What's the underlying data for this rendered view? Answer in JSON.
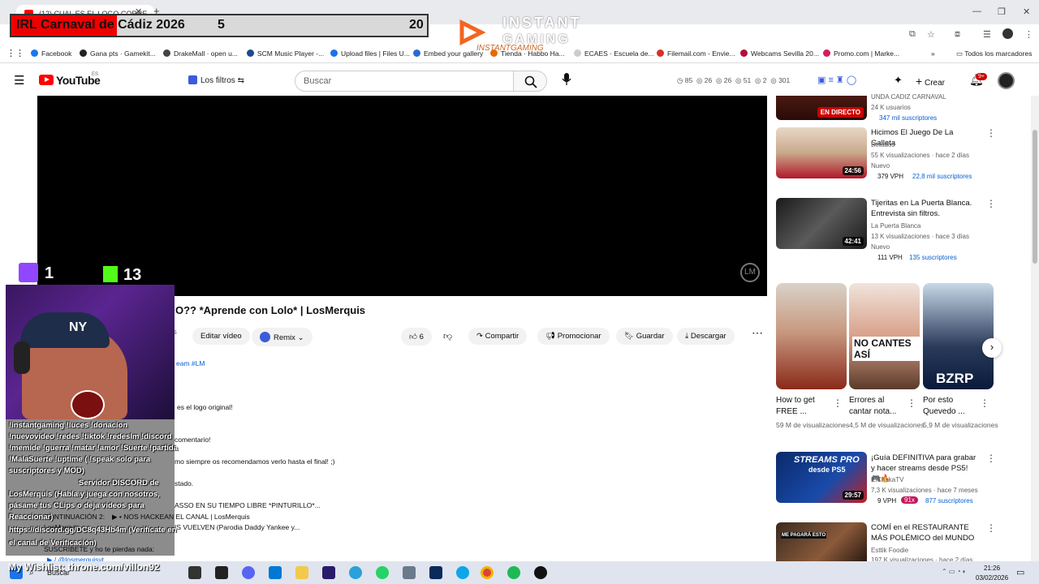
{
  "browser": {
    "tab_title": "(12) CUAL ES EL LOGO CORRE...",
    "new_tab": "+",
    "close": "✕"
  },
  "overlay": {
    "event_title": "IRL Carnaval de Cádiz 2026",
    "score_left": "5",
    "score_right": "20",
    "brand_line1": "INSTANT",
    "brand_line2": "GAMING",
    "brand_sub": "INSTANTGAMING",
    "twitch_count": "1",
    "kick_count": "13",
    "wishlist": "My Wishlist: throne.com/villon92"
  },
  "bookmarks": [
    {
      "label": "Facebook",
      "color": "#1877f2"
    },
    {
      "label": "Gana pts · Gamekit...",
      "color": "#222222"
    },
    {
      "label": "DrakeMall · open u...",
      "color": "#444444"
    },
    {
      "label": "SCM Music Player -...",
      "color": "#1a4c8b"
    },
    {
      "label": "Upload files | Files U...",
      "color": "#1a73e8"
    },
    {
      "label": "Embed your gallery",
      "color": "#2a6bd1"
    },
    {
      "label": "Tienda · Habbo Ha...",
      "color": "#e36b00"
    },
    {
      "label": "ECAES · Escuela de...",
      "color": "#cccccc"
    },
    {
      "label": "Filemail.com - Envie...",
      "color": "#d93025"
    },
    {
      "label": "Webcams Sevilla 20...",
      "color": "#b0113a"
    },
    {
      "label": "Promo.com | Marke...",
      "color": "#d81b60"
    }
  ],
  "bookmarks_all": "Todos los marcadores",
  "youtube": {
    "logo": "YouTube",
    "region": "ES",
    "filters": "Los filtros",
    "search_placeholder": "Buscar",
    "stats": [
      "85",
      "26",
      "26",
      "51",
      "2",
      "301"
    ],
    "create": "Crear",
    "notif_count": "9+"
  },
  "video": {
    "title": "O?? *Aprende con Lolo* | LosMerquis",
    "edit": "Editar vídeo",
    "remix": "Remix",
    "likes": "6",
    "share": "Compartir",
    "promote": "Promocionar",
    "save": "Guardar",
    "download": "Descargar",
    "more": "⋯",
    "watermark": "LM",
    "tags_partial": "eam #LM",
    "desc_lines": [
      "es el logo original!",
      "comentario!",
      "mo siempre os recomendamos verlo hasta el final! ;)",
      "stado.",
      "ASSO EN SU TIEMPO LIBRE *PINTURILLO*...",
      "▶ • NOS HACKEAN EL CANAL  | LosMerquis",
      "IS VUELVEN (Parodia Daddy Yankee y...",
      "SUSCRÍBETE y no te pierdas nada:",
      "▶ / @losmerquisyt"
    ],
    "desc_prefixes": [
      "CONTINUACIÓN 2:",
      "LosMerquis"
    ]
  },
  "chat": [
    "!instantgaming !luces !donacion",
    "!nuevovideo !redes !tiktok !redesIm !discord",
    "!memide !guerra !matar !amor !Suerte !partida",
    "!MalaSuerte !uptime ( !speak solo para",
    "suscriptores y MOD)",
    "Servidor DISCORD de",
    "LosMerquis (Habla y juega con nosotros,",
    "pásame tus CLips o deja videos para",
    "Reaccionar)",
    "https://discord.gg/DC8q43Hb4m (Verifícate en",
    "el canal de Verificación)"
  ],
  "sidebar": [
    {
      "title": "",
      "channel": "UNDA CADIZ CARNAVAL",
      "subs_count": "24 K usuarios",
      "extra": "347 mil suscriptores",
      "badge": "EN DIRECTO",
      "type": "live"
    },
    {
      "title": "Hicimos El Juego De La Galleta",
      "channel": "Betados",
      "views": "55 K visualizaciones · hace 2 días",
      "tag": "Nuevo",
      "vph": "379 VPH",
      "subs": "22,8 mil suscriptores",
      "duration": "24:56"
    },
    {
      "title": "Tijeritas en La Puerta Blanca. Entrevista sin filtros.",
      "channel": "La Puerta Blanca",
      "views": "13 K visualizaciones · hace 3 días",
      "tag": "Nuevo",
      "vph": "111 VPH",
      "subs": "135 suscriptores",
      "duration": "42:41"
    },
    {
      "title": "¡Guía DEFINITIVA para grabar y hacer streams desde PS5! 🎮🔥",
      "channel": "ElChakaTV",
      "views": "7,3 K visualizaciones · hace 7 meses",
      "vph": "9 VPH",
      "ratio": "91x",
      "subs": "877 suscriptores",
      "duration": "29:57"
    },
    {
      "title": "COMÍ en el RESTAURANTE MÁS POLÉMICO del MUNDO",
      "channel": "Esttik Foodie",
      "views": "197 K visualizaciones · hace 2 días"
    }
  ],
  "shorts": [
    {
      "title": "How to get FREE ...",
      "views": "59 M de visualizaciones",
      "overlay": ""
    },
    {
      "title": "Errores al cantar nota...",
      "views": "4,5 M de visualizaciones",
      "overlay": "NO CANTES ASÍ"
    },
    {
      "title": "Por esto Quevedo ...",
      "views": "5,9 M de visualizaciones",
      "overlay": "BZRP"
    }
  ],
  "thumb_texts": {
    "streams": "STREAMS PRO",
    "ps5": "desde PS5",
    "rest": "ME PAGARÁ ESTO"
  },
  "taskbar": {
    "search": "Buscar",
    "time": "21:26",
    "date": "03/02/2026"
  }
}
